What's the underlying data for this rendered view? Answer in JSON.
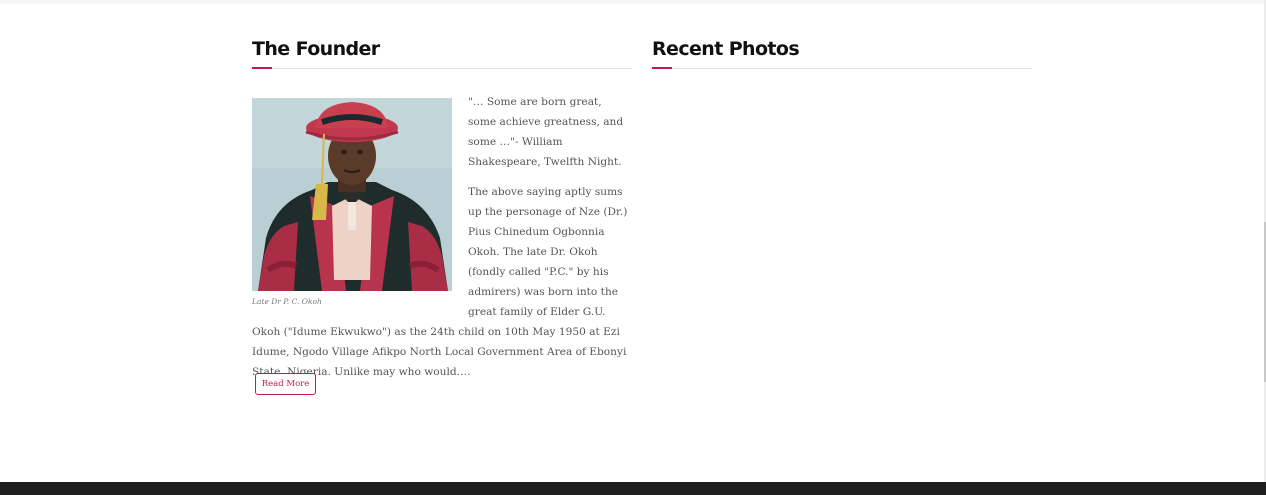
{
  "founder": {
    "title": "The Founder",
    "photo_caption": "Late Dr P. C. Okoh",
    "quote": "\"… Some are born great, some achieve greatness, and some …\"- William Shakespeare, Twelfth Night.",
    "bio": "The above saying aptly sums up the personage of Nze (Dr.) Pius Chinedum Ogbonnia Okoh. The late Dr. Okoh (fondly called \"P.C.\" by his admirers) was born into the great family of Elder G.U. Okoh (\"Idume Ekwukwo\") as the 24th child on 10th May 1950 at Ezi Idume, Ngodo Village Afikpo North Local Government Area of Ebonyi State, Nigeria. Unlike may who would….",
    "read_more_label": "Read More"
  },
  "recent_photos": {
    "title": "Recent Photos"
  },
  "colors": {
    "accent": "#c2185b",
    "footer": "#1e1e1e",
    "text": "#555555",
    "heading": "#111111"
  }
}
